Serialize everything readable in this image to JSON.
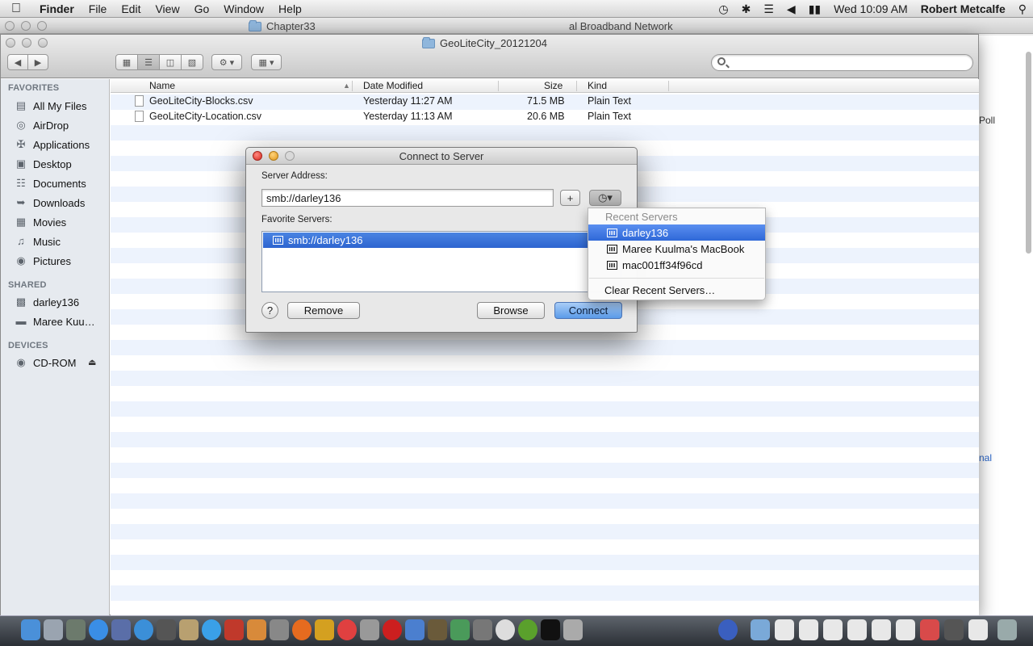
{
  "menubar": {
    "app_name": "Finder",
    "items": [
      "File",
      "Edit",
      "View",
      "Go",
      "Window",
      "Help"
    ],
    "clock": "Wed 10:09 AM",
    "user": "Robert Metcalfe"
  },
  "background_window": {
    "title": "Chapter33",
    "partial_title": "al Broadband Network",
    "side_text_1": "Poll",
    "side_link": "nal"
  },
  "finder": {
    "title": "GeoLiteCity_20121204",
    "sidebar": {
      "favorites_header": "FAVORITES",
      "favorites": [
        {
          "label": "All My Files",
          "icon": "all-files-icon"
        },
        {
          "label": "AirDrop",
          "icon": "airdrop-icon"
        },
        {
          "label": "Applications",
          "icon": "applications-icon"
        },
        {
          "label": "Desktop",
          "icon": "desktop-icon"
        },
        {
          "label": "Documents",
          "icon": "documents-icon"
        },
        {
          "label": "Downloads",
          "icon": "downloads-icon"
        },
        {
          "label": "Movies",
          "icon": "movies-icon"
        },
        {
          "label": "Music",
          "icon": "music-icon"
        },
        {
          "label": "Pictures",
          "icon": "pictures-icon"
        }
      ],
      "shared_header": "SHARED",
      "shared": [
        {
          "label": "darley136",
          "icon": "computer-icon"
        },
        {
          "label": "Maree Kuu…",
          "icon": "laptop-icon"
        }
      ],
      "devices_header": "DEVICES",
      "devices": [
        {
          "label": "CD-ROM",
          "icon": "cdrom-icon"
        }
      ]
    },
    "columns": {
      "name": "Name",
      "date": "Date Modified",
      "size": "Size",
      "kind": "Kind"
    },
    "files": [
      {
        "name": "GeoLiteCity-Blocks.csv",
        "date": "Yesterday 11:27 AM",
        "size": "71.5 MB",
        "kind": "Plain Text"
      },
      {
        "name": "GeoLiteCity-Location.csv",
        "date": "Yesterday 11:13 AM",
        "size": "20.6 MB",
        "kind": "Plain Text"
      }
    ]
  },
  "dialog": {
    "title": "Connect to Server",
    "server_address_label": "Server Address:",
    "server_address_value": "smb://darley136",
    "add_button": "+",
    "favorite_servers_label": "Favorite Servers:",
    "favorites": [
      "smb://darley136"
    ],
    "help_button": "?",
    "remove_button": "Remove",
    "browse_button": "Browse",
    "connect_button": "Connect"
  },
  "recent_menu": {
    "header": "Recent Servers",
    "items": [
      "darley136",
      "Maree Kuulma's MacBook",
      "mac001ff34f96cd"
    ],
    "clear": "Clear Recent Servers…"
  },
  "colors": {
    "selection": "#2d64d0",
    "default_button": "#5b9be9",
    "sidebar_bg": "#e6eaef"
  }
}
